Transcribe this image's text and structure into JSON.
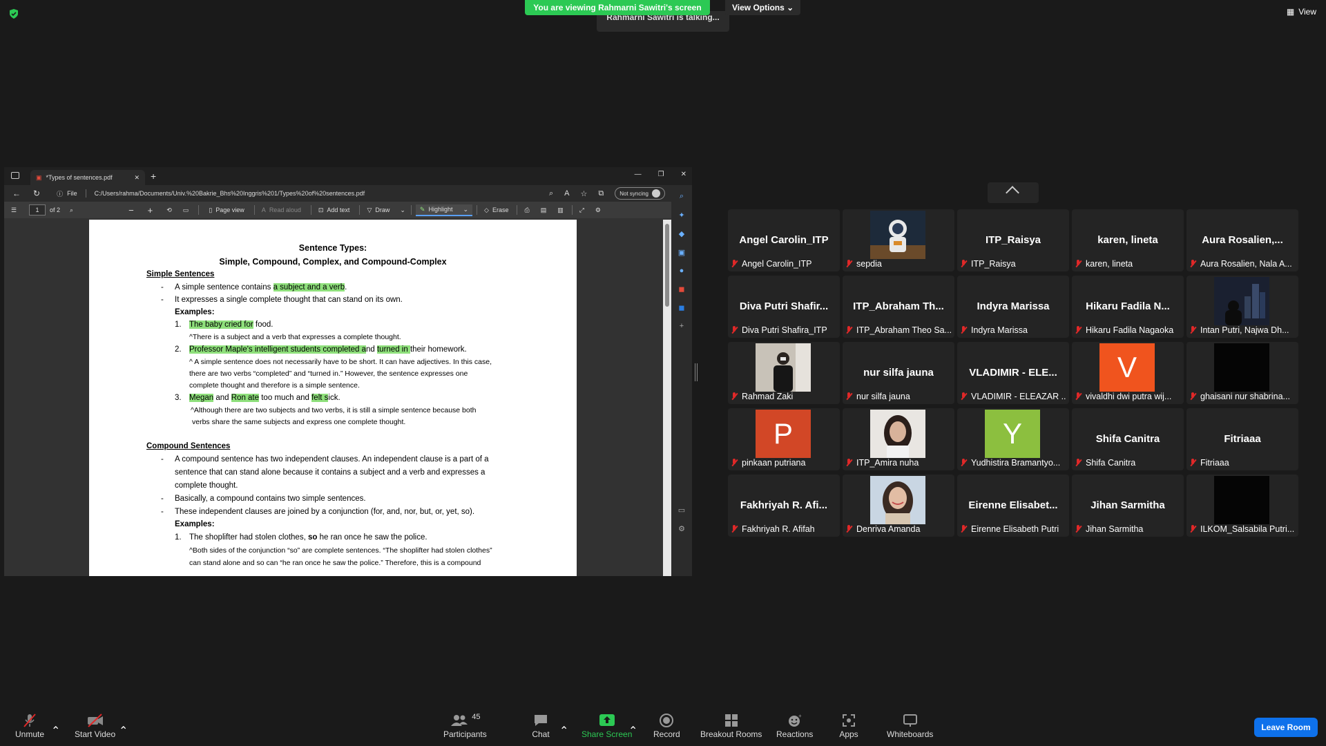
{
  "zoom": {
    "viewing_banner": "You are viewing Rahmarni Sawitri's screen",
    "view_options": "View Options",
    "talking": "Rahmarni Sawitri is talking...",
    "view_label": "View"
  },
  "browser": {
    "tab_title": "*Types of sentences.pdf",
    "address_prefix": "File",
    "url": "C:/Users/rahma/Documents/Univ.%20Bakrie_Bhs%20Inggris%201/Types%20of%20sentences.pdf",
    "sync": "Not syncing",
    "page_number": "1",
    "page_total": "of 2",
    "tools": {
      "page_view": "Page view",
      "read_aloud": "Read aloud",
      "add_text": "Add text",
      "draw": "Draw",
      "highlight": "Highlight",
      "erase": "Erase"
    }
  },
  "doc": {
    "title1": "Sentence Types:",
    "title2": "Simple, Compound, Complex, and Compound-Complex",
    "simple_heading": "Simple Sentences",
    "s1_pre": "A simple sentence contains ",
    "s1_hl": "a subject and a verb",
    "s1_post": ".",
    "s2": "It expresses a single complete thought that can stand on its own.",
    "examples": "Examples:",
    "e1_hl": "The baby cried for",
    "e1_post": " food.",
    "e1_note": "^There is a subject and a verb that expresses a complete thought.",
    "e2_hl1": "Professor Maple's intelligent students completed a",
    "e2_mid": "nd ",
    "e2_hl2": "turned in ",
    "e2_post": "their homework.",
    "e2_note1": "^ A simple sentence does not necessarily have to be short. It can have adjectives. In this case,",
    "e2_note2": "there are two verbs “completed” and “turned in.” However, the sentence expresses one",
    "e2_note3": "complete thought and therefore is a simple sentence.",
    "e3_hl1": "Megan",
    "e3_a": " and ",
    "e3_hl2": "Ron ate",
    "e3_b": " too much and ",
    "e3_hl3": "felt s",
    "e3_c": "ick.",
    "e3_note1": "^Although there are two subjects and two verbs, it is still a simple sentence because both",
    "e3_note2": "verbs share the same subjects and express one complete thought.",
    "compound_heading": "Compound Sentences",
    "c1a": "A compound sentence has two independent clauses. An independent clause is a part of a",
    "c1b": "sentence that can stand alone because it contains a subject and a verb and expresses a",
    "c1c": "complete thought.",
    "c2": "Basically, a compound contains two simple sentences.",
    "c3": "These independent clauses are joined by a conjunction (for, and, nor, but, or, yet, so).",
    "ce1_pre": "The shoplifter had stolen clothes, ",
    "ce1_bold": "so",
    "ce1_post": " he ran once he saw the police.",
    "ce1_note1": "^Both sides of the conjunction “so” are complete sentences. “The shoplifter had stolen clothes”",
    "ce1_note2": "can stand alone and so can “he ran once he saw the police.” Therefore, this is a compound"
  },
  "participants": [
    {
      "big": "Angel Carolin_ITP",
      "name": "Angel Carolin_ITP"
    },
    {
      "big": "",
      "name": "sepdia",
      "photo": "astronaut"
    },
    {
      "big": "ITP_Raisya",
      "name": "ITP_Raisya"
    },
    {
      "big": "karen, lineta",
      "name": "karen, lineta"
    },
    {
      "big": "Aura  Rosalien,...",
      "name": "Aura Rosalien, Nala A..."
    },
    {
      "big": "Diva  Putri  Shafir...",
      "name": "Diva Putri Shafira_ITP"
    },
    {
      "big": "ITP_Abraham  Th...",
      "name": "ITP_Abraham Theo Sa..."
    },
    {
      "big": "Indyra Marissa",
      "name": "Indyra Marissa"
    },
    {
      "big": "Hikaru  Fadila  N...",
      "name": "Hikaru Fadila Nagaoka"
    },
    {
      "big": "",
      "name": "Intan Putri, Najwa Dh...",
      "photo": "city"
    },
    {
      "big": "",
      "name": "Rahmad Zaki",
      "photo": "person"
    },
    {
      "big": "nur silfa jauna",
      "name": "nur silfa jauna"
    },
    {
      "big": "VLADIMIR  -  ELE...",
      "name": "VLADIMIR - ELEAZAR ..."
    },
    {
      "big": "",
      "name": "vivaldhi dwi putra wij...",
      "letter": "V",
      "color": "#f0541e"
    },
    {
      "big": "",
      "name": "ghaisani nur shabrina...",
      "photo": "dark"
    },
    {
      "big": "",
      "name": "pinkaan putriana",
      "letter": "P",
      "color": "#d24726"
    },
    {
      "big": "",
      "name": "ITP_Amira nuha",
      "photo": "girl"
    },
    {
      "big": "",
      "name": "Yudhistira Bramantyo...",
      "letter": "Y",
      "color": "#8cbf3f"
    },
    {
      "big": "Shifa Canitra",
      "name": "Shifa Canitra"
    },
    {
      "big": "Fitriaaa",
      "name": "Fitriaaa"
    },
    {
      "big": "Fakhriyah  R.  Afi...",
      "name": "Fakhriyah R. Afifah"
    },
    {
      "big": "",
      "name": "Denriva Amanda",
      "photo": "girl2"
    },
    {
      "big": "Eirenne  Elisabet...",
      "name": "Eirenne Elisabeth Putri"
    },
    {
      "big": "Jihan Sarmitha",
      "name": "Jihan Sarmitha"
    },
    {
      "big": "",
      "name": "ILKOM_Salsabila Putri...",
      "photo": "dark"
    }
  ],
  "toolbar": {
    "unmute": "Unmute",
    "start_video": "Start Video",
    "participants_count": "45",
    "participants": "Participants",
    "chat": "Chat",
    "share_screen": "Share Screen",
    "record": "Record",
    "breakout": "Breakout Rooms",
    "reactions": "Reactions",
    "apps": "Apps",
    "whiteboards": "Whiteboards",
    "leave": "Leave Room"
  }
}
